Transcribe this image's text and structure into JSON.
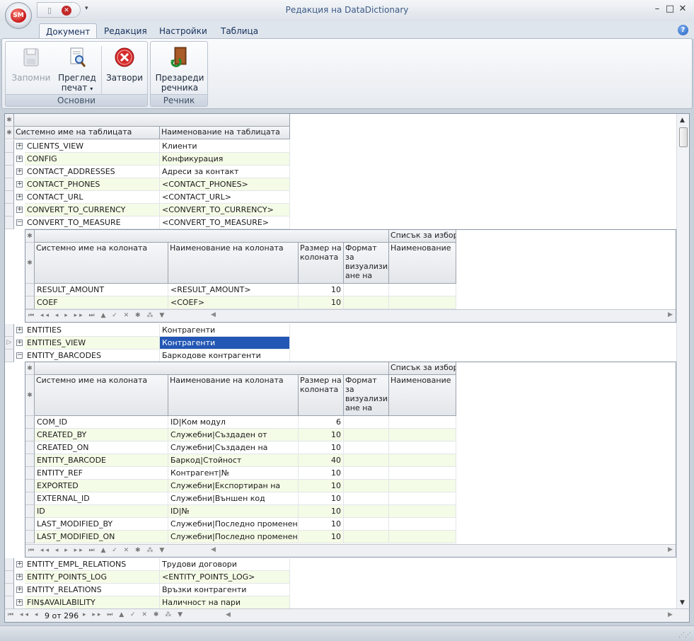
{
  "window": {
    "title": "Редакция на DataDictionary",
    "orb_label": "SM",
    "controls": {
      "minimize": "–",
      "maximize": "□",
      "close": "✕"
    },
    "help_label": "?"
  },
  "ribbon": {
    "tabs": [
      "Документ",
      "Редакция",
      "Настройки",
      "Таблица"
    ],
    "active_tab": "Документ",
    "groups": {
      "main": {
        "label": "Основни",
        "save": "Запомни",
        "preview_line1": "Преглед",
        "preview_line2": "печат",
        "close": "Затвори"
      },
      "dictionary": {
        "label": "Речник",
        "reload_line1": "Презареди",
        "reload_line2": "речника"
      }
    }
  },
  "grid": {
    "columns": {
      "system_name": "Системно име на таблицата",
      "display_name": "Наименование на таблицата"
    },
    "rows_top": [
      {
        "sys": "CLIENTS_VIEW",
        "name": "Клиенти"
      },
      {
        "sys": "CONFIG",
        "name": "Конфикурация"
      },
      {
        "sys": "CONTACT_ADDRESSES",
        "name": "Адреси за контакт"
      },
      {
        "sys": "CONTACT_PHONES",
        "name": "<CONTACT_PHONES>"
      },
      {
        "sys": "CONTACT_URL",
        "name": "<CONTACT_URL>"
      },
      {
        "sys": "CONVERT_TO_CURRENCY",
        "name": "<CONVERT_TO_CURRENCY>"
      },
      {
        "sys": "CONVERT_TO_MEASURE",
        "name": "<CONVERT_TO_MEASURE>"
      }
    ],
    "rows_mid": [
      {
        "sys": "ENTITIES",
        "name": "Контрагенти"
      },
      {
        "sys": "ENTITIES_VIEW",
        "name": "Контрагенти"
      },
      {
        "sys": "ENTITY_BARCODES",
        "name": "Баркодове контрагенти"
      }
    ],
    "rows_bottom": [
      {
        "sys": "ENTITY_EMPL_RELATIONS",
        "name": "Трудови договори"
      },
      {
        "sys": "ENTITY_POINTS_LOG",
        "name": "<ENTITY_POINTS_LOG>"
      },
      {
        "sys": "ENTITY_RELATIONS",
        "name": "Връзки контрагенти"
      },
      {
        "sys": "FIN$AVAILABILITY",
        "name": "Наличност на пари"
      }
    ],
    "detail_columns": {
      "band": "Списък за избор",
      "col_sys": "Системно име на колоната",
      "col_name": "Наименование на колоната",
      "col_size": "Размер на колоната",
      "col_format": "Формат за визуализир ане на данните",
      "col_lookup": "Наименование"
    },
    "detail1_rows": [
      {
        "sys": "RESULT_AMOUNT",
        "name": "<RESULT_AMOUNT>",
        "size": "10"
      },
      {
        "sys": "COEF",
        "name": "<COEF>",
        "size": "10"
      }
    ],
    "detail2_rows": [
      {
        "sys": "COM_ID",
        "name": "ID|Ком модул",
        "size": "6"
      },
      {
        "sys": "CREATED_BY",
        "name": "Служебни|Създаден от",
        "size": "10"
      },
      {
        "sys": "CREATED_ON",
        "name": "Служебни|Създаден на",
        "size": "10"
      },
      {
        "sys": "ENTITY_BARCODE",
        "name": "Баркод|Стойност",
        "size": "40"
      },
      {
        "sys": "ENTITY_REF",
        "name": "Контрагент|№",
        "size": "10"
      },
      {
        "sys": "EXPORTED",
        "name": "Служебни|Експортиран на",
        "size": "10"
      },
      {
        "sys": "EXTERNAL_ID",
        "name": "Служебни|Външен код",
        "size": "10"
      },
      {
        "sys": "ID",
        "name": "ID|№",
        "size": "10"
      },
      {
        "sys": "LAST_MODIFIED_BY",
        "name": "Служебни|Последно променен от",
        "size": "10"
      },
      {
        "sys": "LAST_MODIFIED_ON",
        "name": "Служебни|Последно променен на",
        "size": "10"
      }
    ],
    "navigator": {
      "record_text": "9 от 296"
    }
  }
}
